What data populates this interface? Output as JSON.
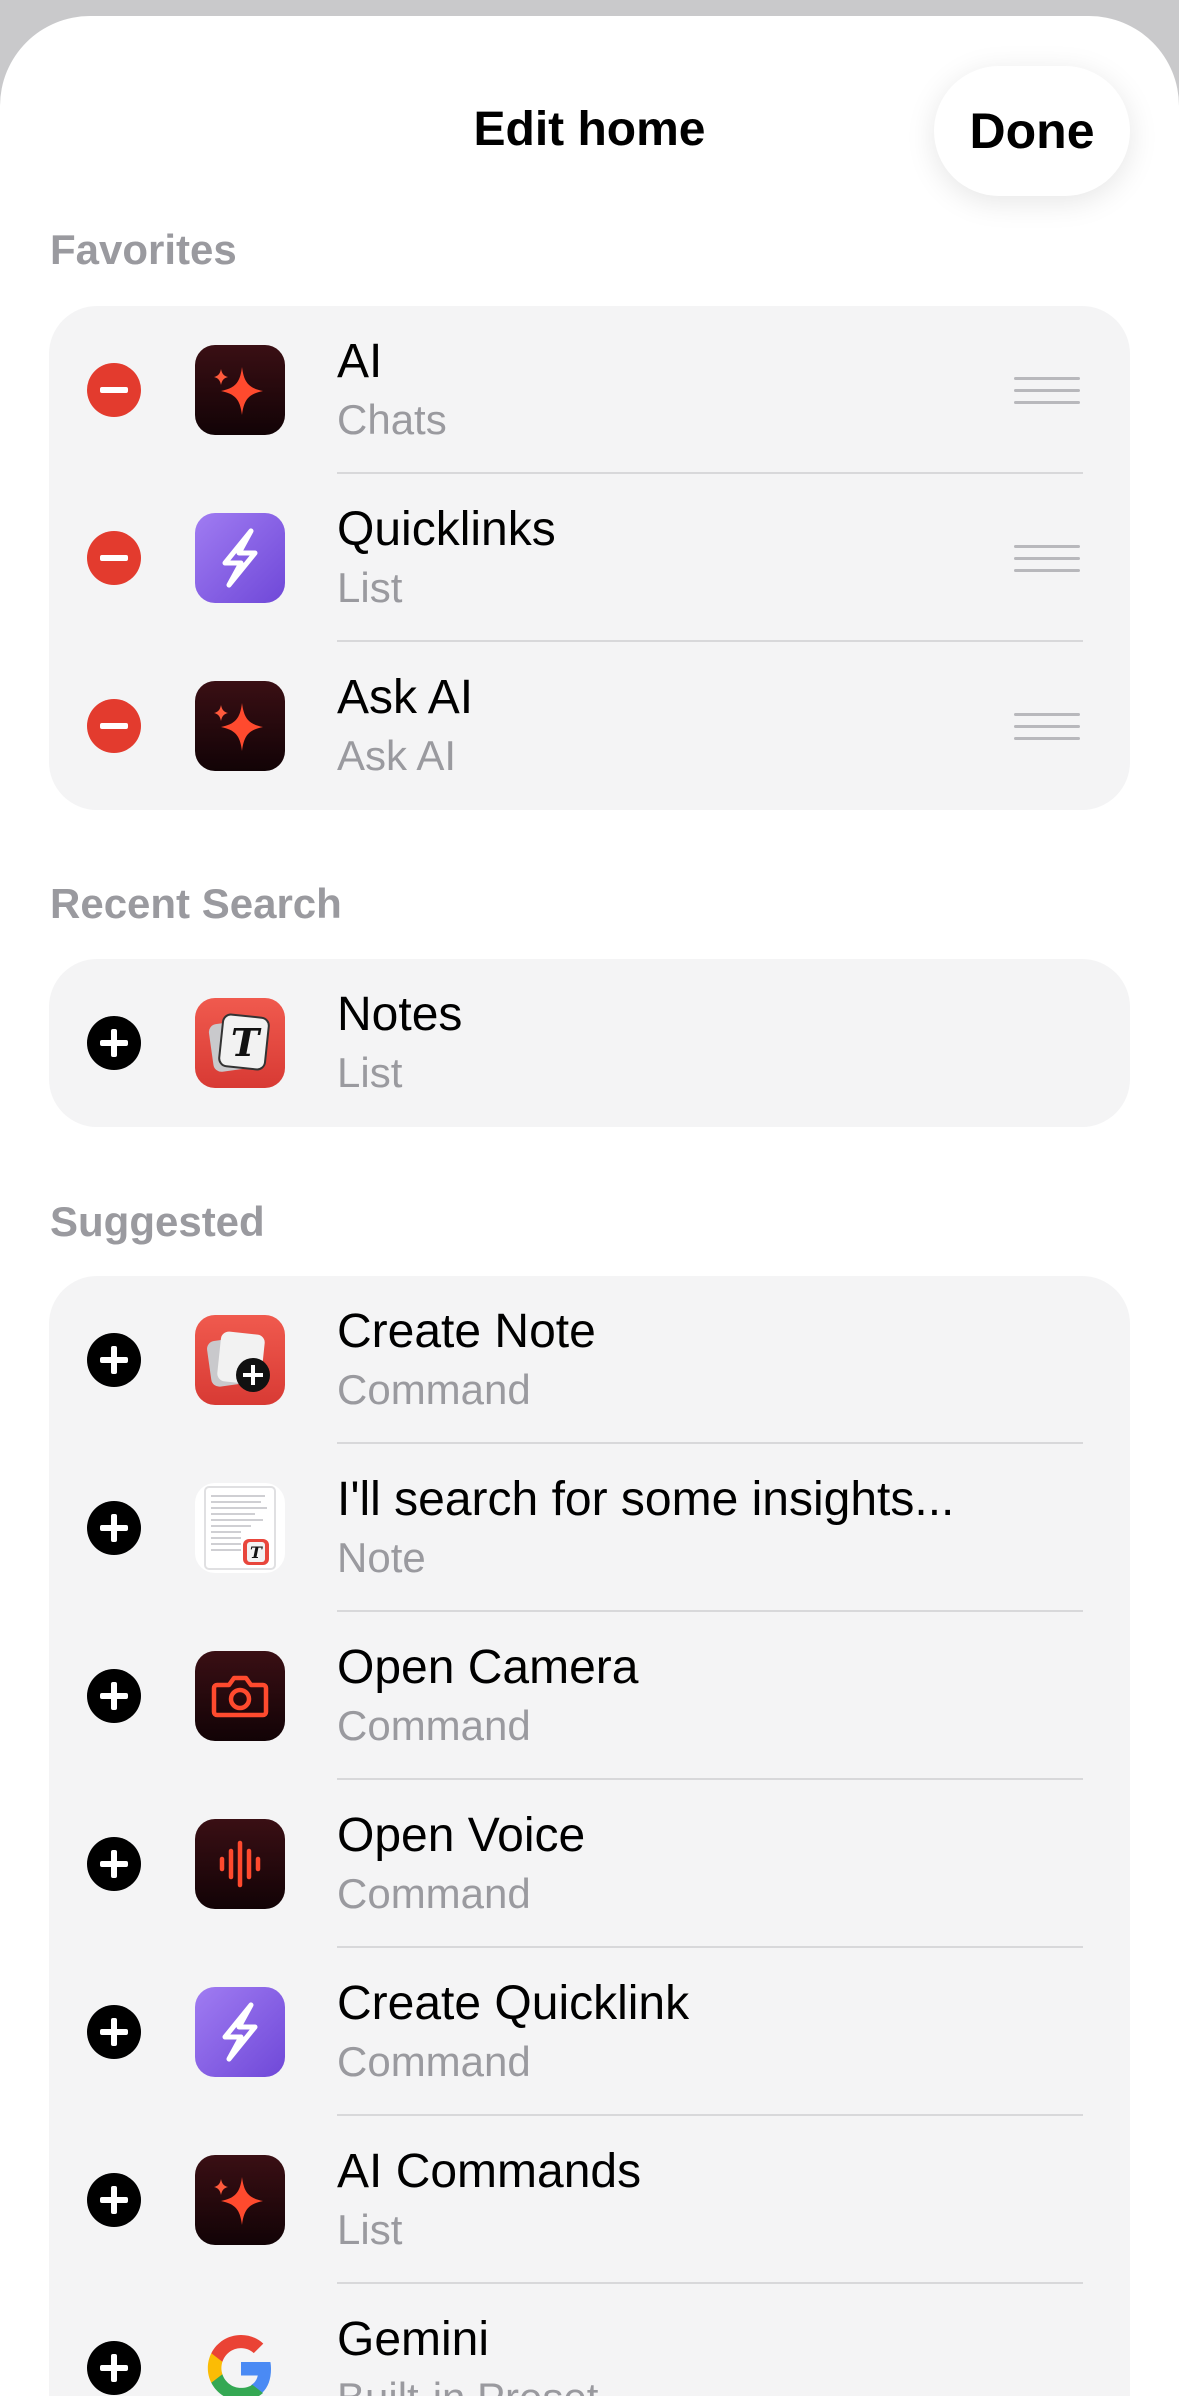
{
  "header": {
    "title": "Edit home",
    "done_label": "Done"
  },
  "sections": {
    "favorites": {
      "label": "Favorites",
      "items": [
        {
          "title": "AI",
          "subtitle": "Chats",
          "icon": "ai-sparkle-icon"
        },
        {
          "title": "Quicklinks",
          "subtitle": "List",
          "icon": "quicklinks-icon"
        },
        {
          "title": "Ask AI",
          "subtitle": "Ask AI",
          "icon": "ai-sparkle-icon"
        }
      ]
    },
    "recent": {
      "label": "Recent Search",
      "items": [
        {
          "title": "Notes",
          "subtitle": "List",
          "icon": "notes-icon"
        }
      ]
    },
    "suggested": {
      "label": "Suggested",
      "items": [
        {
          "title": "Create Note",
          "subtitle": "Command",
          "icon": "create-note-icon"
        },
        {
          "title": "I'll search for some insights...",
          "subtitle": "Note",
          "icon": "note-document-icon"
        },
        {
          "title": "Open Camera",
          "subtitle": "Command",
          "icon": "camera-icon"
        },
        {
          "title": "Open Voice",
          "subtitle": "Command",
          "icon": "voice-waveform-icon"
        },
        {
          "title": "Create Quicklink",
          "subtitle": "Command",
          "icon": "quicklinks-icon"
        },
        {
          "title": "AI Commands",
          "subtitle": "List",
          "icon": "ai-sparkle-icon"
        },
        {
          "title": "Gemini",
          "subtitle": "Built-in Preset",
          "icon": "google-g-icon"
        }
      ]
    }
  },
  "colors": {
    "remove": "#e33b2e",
    "add": "#000000",
    "accent_red": "#e8412f",
    "quicklink_purple": "#8a63e6",
    "card_bg": "#f4f4f5",
    "secondary_text": "#9a9a9f"
  }
}
